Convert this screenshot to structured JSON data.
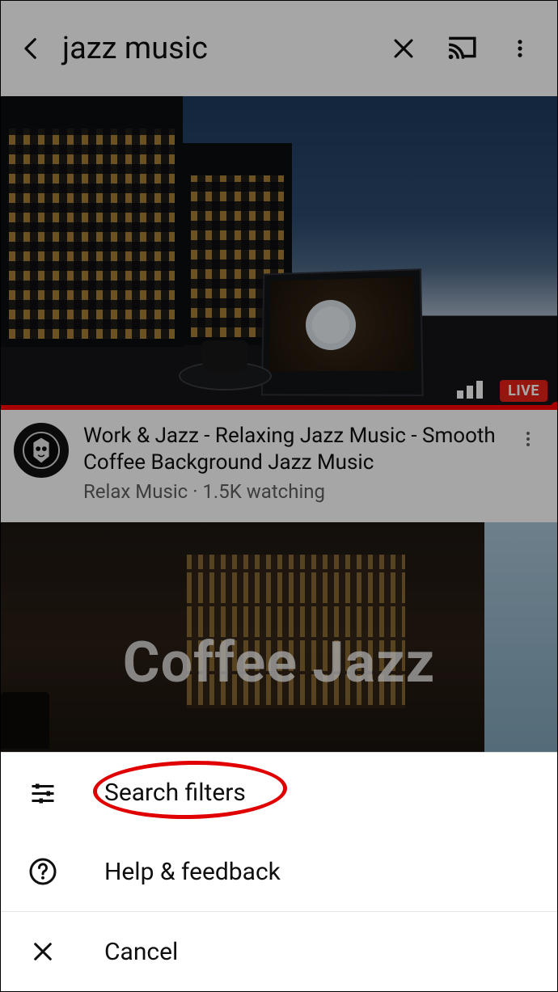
{
  "header": {
    "search_query": "jazz music"
  },
  "results": [
    {
      "live_label": "LIVE",
      "title": "Work & Jazz - Relaxing Jazz Music -  Smooth Coffee Background Jazz Music",
      "channel": "Relax Music",
      "watching": "1.5K watching"
    },
    {
      "overlay_text": "Coffee Jazz"
    }
  ],
  "sheet": {
    "items": [
      {
        "icon": "filter-icon",
        "label": "Search filters"
      },
      {
        "icon": "help-icon",
        "label": "Help & feedback"
      },
      {
        "icon": "close-icon",
        "label": "Cancel"
      }
    ]
  }
}
